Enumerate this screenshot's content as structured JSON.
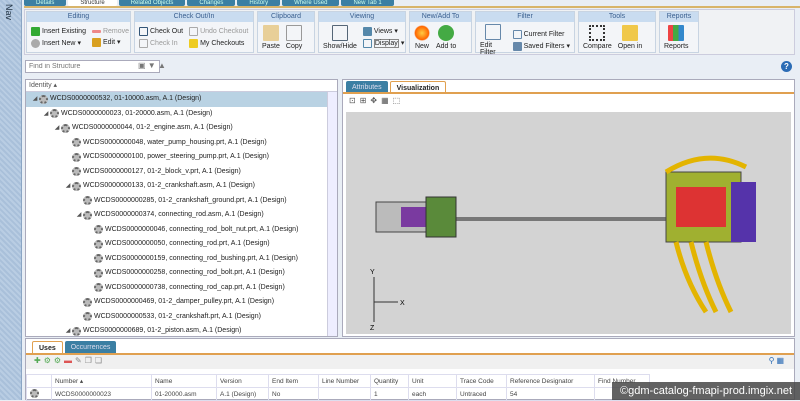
{
  "nav": {
    "label": "Nav"
  },
  "top_tabs": [
    "Details",
    "Structure",
    "Related Objects",
    "Changes",
    "History",
    "Where Used",
    "New Tab 1"
  ],
  "ribbon": {
    "editing": {
      "title": "Editing",
      "insert_existing": "Insert Existing",
      "remove": "Remove",
      "insert_new": "Insert New",
      "edit": "Edit"
    },
    "checkout": {
      "title": "Check Out/In",
      "check_out": "Check Out",
      "undo_checkout": "Undo Checkout",
      "check_in": "Check In",
      "my_checkouts": "My Checkouts"
    },
    "clipboard": {
      "title": "Clipboard",
      "paste": "Paste",
      "copy": "Copy"
    },
    "viewing": {
      "title": "Viewing",
      "show_hide": "Show/Hide",
      "views": "Views",
      "display": "Display"
    },
    "newadd": {
      "title": "New/Add To",
      "new": "New",
      "add_to": "Add to"
    },
    "filter": {
      "title": "Filter",
      "edit_filter": "Edit Filter",
      "current_filter": "Current Filter",
      "saved_filters": "Saved Filters"
    },
    "tools": {
      "title": "Tools",
      "compare": "Compare",
      "open_in": "Open in"
    },
    "reports": {
      "title": "Reports",
      "reports": "Reports"
    }
  },
  "find": {
    "placeholder": "Find in Structure"
  },
  "tree": {
    "header": "Identity ▴",
    "rows": [
      {
        "level": 0,
        "text": "WCDS0000000532, 01-10000.asm, A.1 (Design)",
        "exp": "◢"
      },
      {
        "level": 1,
        "text": "WCDS0000000023, 01-20000.asm, A.1 (Design)",
        "exp": "◢"
      },
      {
        "level": 2,
        "text": "WCDS0000000044, 01-2_engine.asm, A.1 (Design)",
        "exp": "◢"
      },
      {
        "level": 3,
        "text": "WCDS0000000048, water_pump_housing.prt, A.1 (Design)",
        "exp": ""
      },
      {
        "level": 3,
        "text": "WCDS0000000100, power_steering_pump.prt, A.1 (Design)",
        "exp": ""
      },
      {
        "level": 3,
        "text": "WCDS0000000127, 01-2_block_v.prt, A.1 (Design)",
        "exp": ""
      },
      {
        "level": 3,
        "text": "WCDS0000000133, 01-2_crankshaft.asm, A.1 (Design)",
        "exp": "◢"
      },
      {
        "level": 4,
        "text": "WCDS0000000285, 01-2_crankshaft_ground.prt, A.1 (Design)",
        "exp": ""
      },
      {
        "level": 4,
        "text": "WCDS0000000374, connecting_rod.asm, A.1 (Design)",
        "exp": "◢"
      },
      {
        "level": 5,
        "text": "WCDS0000000046, connecting_rod_bolt_nut.prt, A.1 (Design)",
        "exp": ""
      },
      {
        "level": 5,
        "text": "WCDS0000000050, connecting_rod.prt, A.1 (Design)",
        "exp": ""
      },
      {
        "level": 5,
        "text": "WCDS0000000159, connecting_rod_bushing.prt, A.1 (Design)",
        "exp": ""
      },
      {
        "level": 5,
        "text": "WCDS0000000258, connecting_rod_bolt.prt, A.1 (Design)",
        "exp": ""
      },
      {
        "level": 5,
        "text": "WCDS0000000738, connecting_rod_cap.prt, A.1 (Design)",
        "exp": ""
      },
      {
        "level": 4,
        "text": "WCDS0000000469, 01-2_damper_pulley.prt, A.1 (Design)",
        "exp": ""
      },
      {
        "level": 4,
        "text": "WCDS0000000533, 01-2_crankshaft.prt, A.1 (Design)",
        "exp": ""
      },
      {
        "level": 3,
        "text": "WCDS0000000689, 01-2_piston.asm, A.1 (Design)",
        "exp": "◢"
      }
    ]
  },
  "right_tabs": {
    "attributes": "Attributes",
    "visualization": "Visualization"
  },
  "axes": {
    "x": "X",
    "y": "Y",
    "z": "Z"
  },
  "bottom_tabs": {
    "uses": "Uses",
    "occurrences": "Occurrences"
  },
  "uses_table": {
    "headers": [
      "Number ▴",
      "Name",
      "Version",
      "End Item",
      "Line Number",
      "Quantity",
      "Unit",
      "Trace Code",
      "Reference Designator",
      "Find Number"
    ],
    "rows": [
      [
        "WCDS0000000023",
        "01-20000.asm",
        "A.1 (Design)",
        "No",
        "",
        "1",
        "each",
        "Untraced",
        "54",
        ""
      ]
    ]
  },
  "watermark": "©gdm-catalog-fmapi-prod.imgix.net"
}
